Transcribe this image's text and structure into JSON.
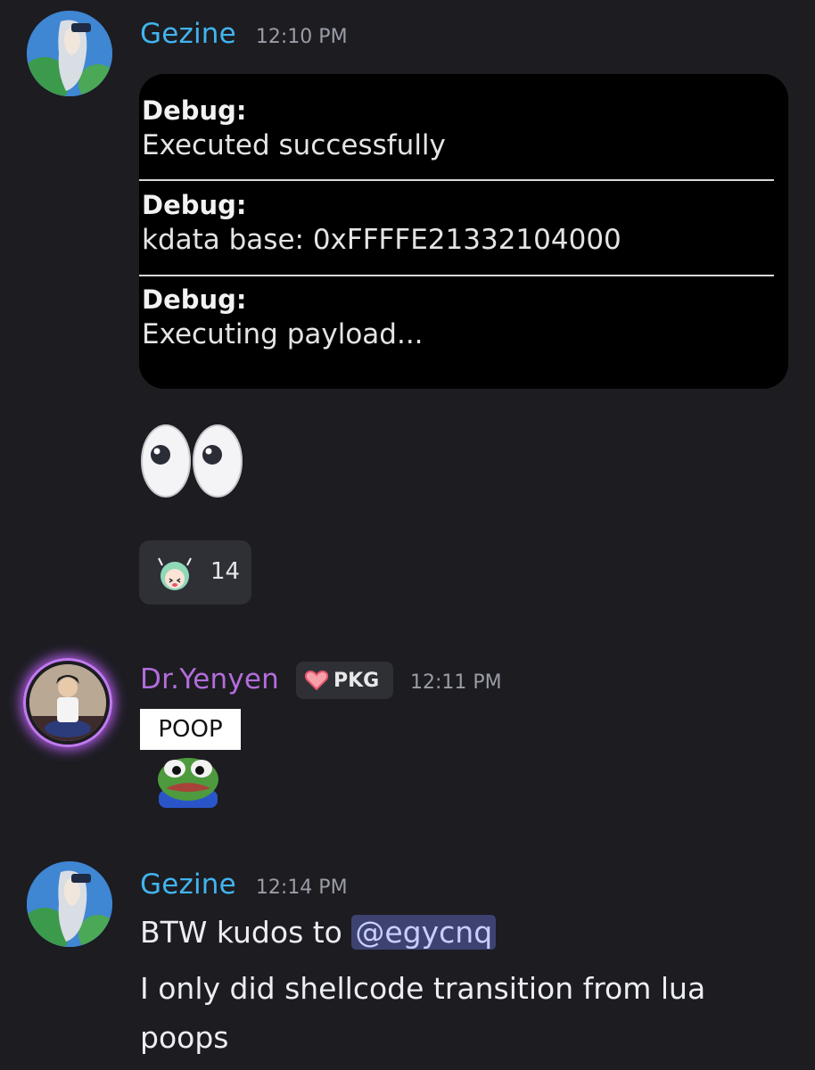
{
  "messages": [
    {
      "author": "Gezine",
      "time": "12:10 PM",
      "author_color": "#42b4ef",
      "embed": [
        {
          "title": "Debug:",
          "body": "Executed successfully"
        },
        {
          "title": "Debug:",
          "body": "kdata base: 0xFFFFE21332104000"
        },
        {
          "title": "Debug:",
          "body": "Executing payload..."
        }
      ],
      "emoji": "eyes-emoji",
      "reaction": {
        "emoji": "anime-girl-emote",
        "count": "14"
      }
    },
    {
      "author": "Dr.Yenyen",
      "author_color": "#b36ddb",
      "tag": {
        "icon": "heart-icon",
        "label": "PKG"
      },
      "time": "12:11 PM",
      "sticker_text": "POOP",
      "emote": "pepe-frog-emote"
    },
    {
      "author": "Gezine",
      "time": "12:14 PM",
      "author_color": "#42b4ef",
      "line1_prefix": "BTW kudos to ",
      "mention": "@egycnq",
      "line2": "I only did shellcode transition from lua",
      "line3": "poops"
    }
  ]
}
